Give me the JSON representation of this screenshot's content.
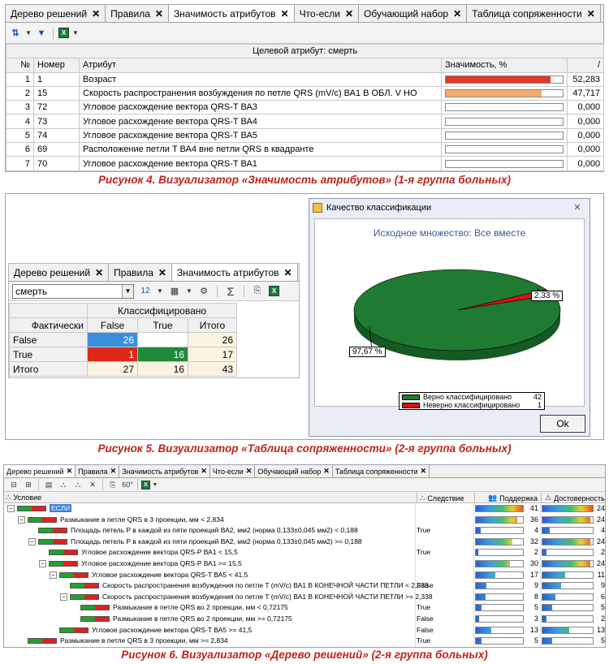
{
  "fig4": {
    "tabs": [
      {
        "label": "Дерево решений"
      },
      {
        "label": "Правила"
      },
      {
        "label": "Значимость атрибутов"
      },
      {
        "label": "Что-если"
      },
      {
        "label": "Обучающий набор"
      },
      {
        "label": "Таблица сопряженности"
      }
    ],
    "target_label": "Целевой атрибут: смерть",
    "columns": {
      "no": "№",
      "num": "Номер",
      "attr": "Атрибут",
      "sig": "Значимость, %"
    },
    "rows": [
      {
        "no": "1",
        "num": "1",
        "attr": "Возраст",
        "value": "52,283",
        "v": 52.283,
        "color": "#e2372b"
      },
      {
        "no": "2",
        "num": "15",
        "attr": "Скорость распространения возбуждения по петле QRS (mV/c) ВА1  В ОБЛ. V НО",
        "value": "47,717",
        "v": 47.717,
        "color": "#f6a96a"
      },
      {
        "no": "3",
        "num": "72",
        "attr": "Угловое расхождение вектора QRS-T ВА3",
        "value": "0,000",
        "v": 0,
        "color": "#fff"
      },
      {
        "no": "4",
        "num": "73",
        "attr": "Угловое расхождение вектора QRS-T ВА4",
        "value": "0,000",
        "v": 0,
        "color": "#fff"
      },
      {
        "no": "5",
        "num": "74",
        "attr": "Угловое расхождение вектора QRS-T  ВА5",
        "value": "0,000",
        "v": 0,
        "color": "#fff"
      },
      {
        "no": "6",
        "num": "69",
        "attr": "Расположение петли T  ВА4 вне петли QRS в квадранте",
        "value": "0,000",
        "v": 0,
        "color": "#fff"
      },
      {
        "no": "7",
        "num": "70",
        "attr": "Угловое расхождение вектора QRS-T ВА1",
        "value": "0,000",
        "v": 0,
        "color": "#fff"
      }
    ],
    "caption": "Рисунок 4. Визуализатор «Значимость атрибутов» (1-я группа больных)"
  },
  "fig5": {
    "tabs": [
      {
        "label": "Дерево решений"
      },
      {
        "label": "Правила"
      },
      {
        "label": "Значимость атрибутов"
      }
    ],
    "select_value": "смерть",
    "ct": {
      "header": "Классифицировано",
      "col_labels": [
        "False",
        "True",
        "Итого"
      ],
      "row_header": "Фактически",
      "rows": [
        {
          "label": "False",
          "cells": [
            "26",
            "",
            "26"
          ]
        },
        {
          "label": "True",
          "cells": [
            "1",
            "16",
            "17"
          ]
        },
        {
          "label": "Итого",
          "cells": [
            "27",
            "16",
            "43"
          ]
        }
      ]
    },
    "dialog": {
      "title": "Качество классификации",
      "subtitle": "Исходное множество: Все вместе",
      "slice_small_label": "2,33 %",
      "slice_large_label": "97,67 %",
      "legend": [
        {
          "label": "Верно классифицировано",
          "count": "42",
          "color": "#1f7a32"
        },
        {
          "label": "Неверно классифицировано",
          "count": "1",
          "color": "#e01010"
        }
      ],
      "ok": "Ok"
    },
    "pie": {
      "values": [
        97.67,
        2.33
      ],
      "colors": [
        "#1f7a32",
        "#e01010"
      ]
    },
    "caption": "Рисунок 5. Визуализатор «Таблица сопряженности» (2-я группа больных)"
  },
  "fig6": {
    "tabs": [
      {
        "label": "Дерево решений"
      },
      {
        "label": "Правила"
      },
      {
        "label": "Значимость атрибутов"
      },
      {
        "label": "Что-если"
      },
      {
        "label": "Обучающий набор"
      },
      {
        "label": "Таблица сопряженности"
      }
    ],
    "columns": {
      "cond": "Условие",
      "res": "Следствие",
      "sup": "Поддержка",
      "conf": "Достоверность"
    },
    "rows": [
      {
        "indent": 0,
        "text": "ЕСЛИ",
        "res": "",
        "sup": "41",
        "conf": "24",
        "sf": 1.0,
        "cf": 1.0,
        "sel": true
      },
      {
        "indent": 1,
        "text": "Размыкание в петле QRS в 3 проекции, мм < 2,834",
        "res": "",
        "sup": "36",
        "conf": "24",
        "sf": 0.88,
        "cf": 0.95
      },
      {
        "indent": 2,
        "text": "Площадь петель P в каждой из пяти проекций ВА2, мм2 (норма 0,133±0,045 мм2) < 0,188",
        "res": "True",
        "sup": "4",
        "conf": "4",
        "sf": 0.1,
        "cf": 0.15
      },
      {
        "indent": 2,
        "text": "Площадь петель P в каждой из пяти проекций ВА2, мм2 (норма 0,133±0,045 мм2) >= 0,188",
        "res": "",
        "sup": "32",
        "conf": "24",
        "sf": 0.78,
        "cf": 0.95
      },
      {
        "indent": 3,
        "text": "Угловое расхождение вектора QRS-P ВА1 < 15,5",
        "res": "True",
        "sup": "2",
        "conf": "2",
        "sf": 0.05,
        "cf": 0.08
      },
      {
        "indent": 3,
        "text": "Угловое расхождение вектора QRS-P ВА1 >= 15,5",
        "res": "",
        "sup": "30",
        "conf": "24",
        "sf": 0.73,
        "cf": 0.95
      },
      {
        "indent": 4,
        "text": "Угловое расхождение вектора QRS-T  ВА5 < 41,5",
        "res": "",
        "sup": "17",
        "conf": "11",
        "sf": 0.42,
        "cf": 0.45
      },
      {
        "indent": 5,
        "text": "Скорость распространения возбуждения по петле T (mV/c) ВА1 В КОНЕЧНОЙ ЧАСТИ ПЕТЛИ < 2,338",
        "res": "False",
        "sup": "9",
        "conf": "9",
        "sf": 0.22,
        "cf": 0.37
      },
      {
        "indent": 5,
        "text": "Скорость распространения возбуждения по петле T (mV/c) ВА1 В КОНЕЧНОЙ ЧАСТИ ПЕТЛИ >= 2,338",
        "res": "",
        "sup": "8",
        "conf": "6",
        "sf": 0.2,
        "cf": 0.25
      },
      {
        "indent": 6,
        "text": "Размыкание в петле QRS во 2 проекции, мм  < 0,72175",
        "res": "True",
        "sup": "5",
        "conf": "5",
        "sf": 0.12,
        "cf": 0.2
      },
      {
        "indent": 6,
        "text": "Размыкание в петле QRS во 2 проекции, мм  >= 0,72175",
        "res": "False",
        "sup": "3",
        "conf": "2",
        "sf": 0.07,
        "cf": 0.08
      },
      {
        "indent": 4,
        "text": "Угловое расхождение вектора QRS-T  ВА5 >= 41,5",
        "res": "False",
        "sup": "13",
        "conf": "13",
        "sf": 0.32,
        "cf": 0.54
      },
      {
        "indent": 1,
        "text": "Размыкание в петле QRS в 3 проекции, мм >= 2,834",
        "res": "True",
        "sup": "5",
        "conf": "5",
        "sf": 0.12,
        "cf": 0.2
      }
    ],
    "caption": "Рисунок 6. Визуализатор «Дерево решений» (2-я группа больных)"
  }
}
